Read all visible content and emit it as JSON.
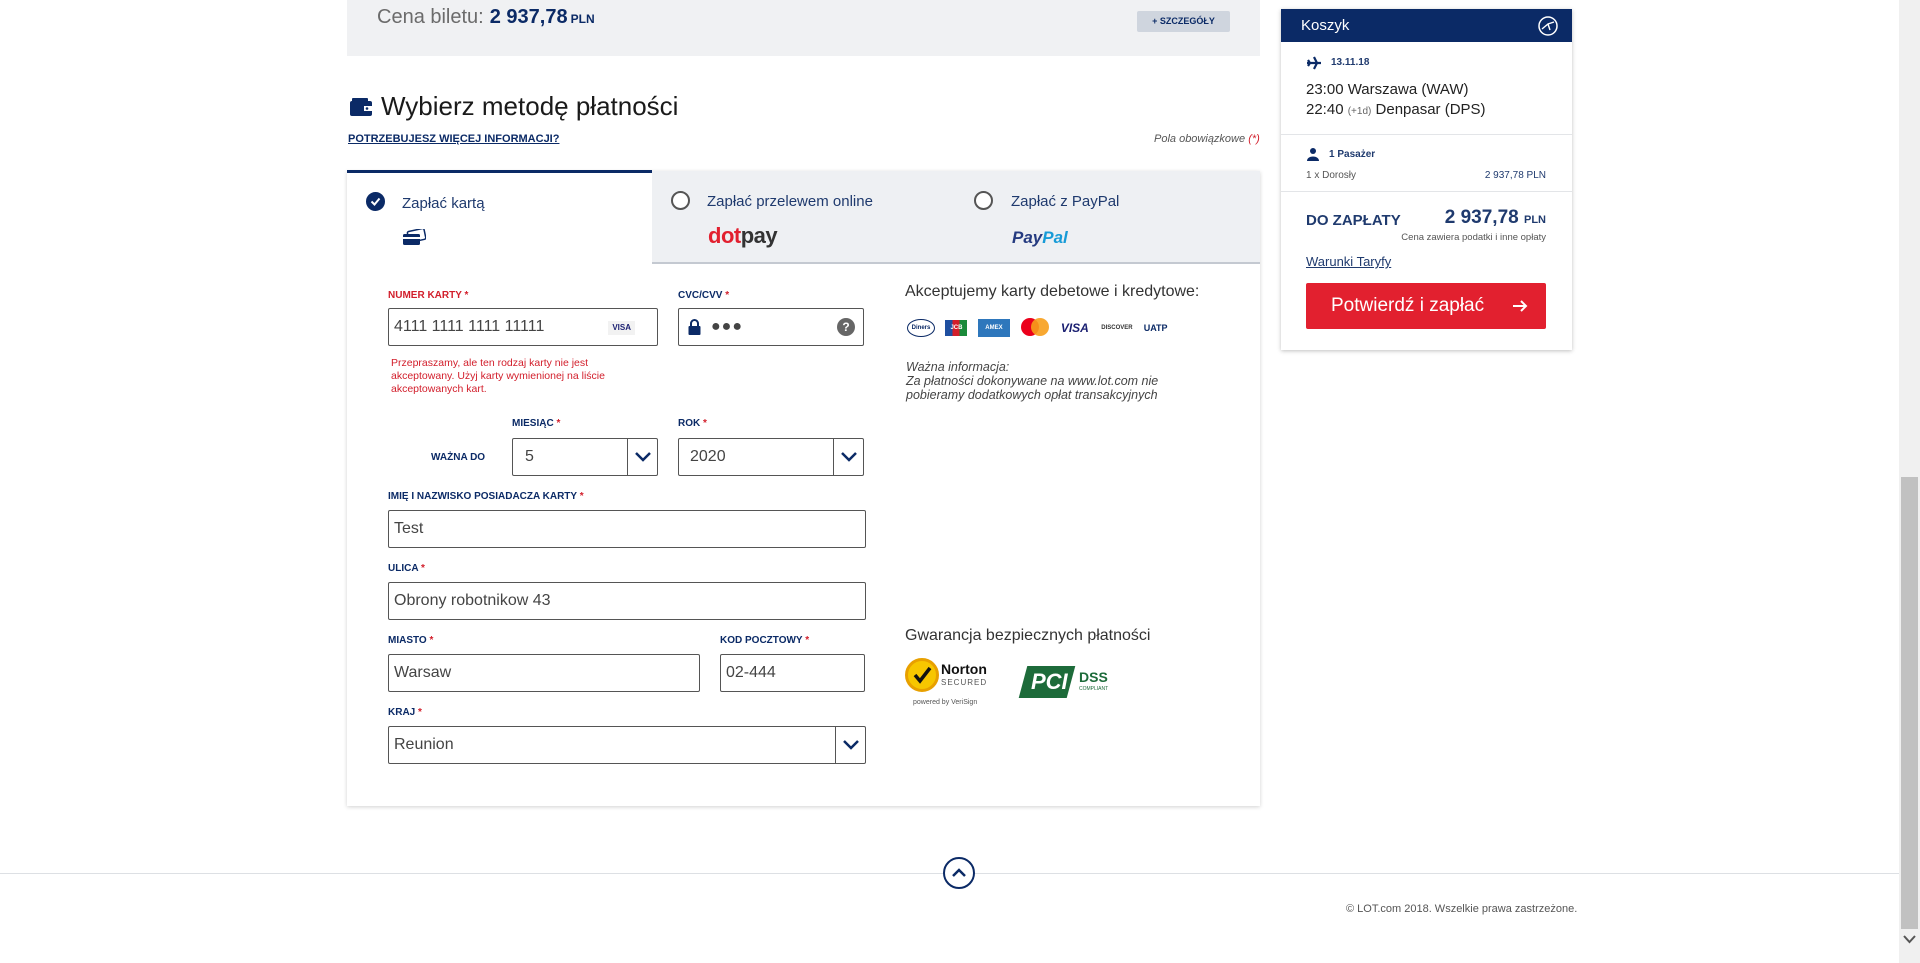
{
  "price_bar": {
    "label": "Cena biletu:",
    "value": "2 937,78",
    "currency": "PLN",
    "details_button": "+ SZCZEGÓŁY"
  },
  "payment_section": {
    "title": "Wybierz metodę płatności",
    "more_info_link": "POTRZEBUJESZ WIĘCEJ INFORMACJI?",
    "required_note": "Pola obowiązkowe",
    "required_star": "(*)"
  },
  "tabs": [
    {
      "label": "Zapłać kartą",
      "selected": true,
      "icon": "credit-card-icon"
    },
    {
      "label": "Zapłać przelewem online",
      "selected": false,
      "logo": "dotpay"
    },
    {
      "label": "Zapłać z PayPal",
      "selected": false,
      "logo": "PayPal"
    }
  ],
  "logos": {
    "dotpay_a": "dot",
    "dotpay_b": "pay",
    "paypal_a": "Pay",
    "paypal_b": "Pal"
  },
  "form": {
    "card_number": {
      "label": "NUMER KARTY",
      "value": "4111 1111 1111 11111",
      "brand": "VISA"
    },
    "card_error": "Przepraszamy, ale ten rodzaj karty nie jest akceptowany. Użyj karty wymienionej na liście akceptowanych kart.",
    "cvc": {
      "label": "CVC/CVV",
      "value": "●●●",
      "help": "?"
    },
    "valid_to_label": "WAŻNA DO",
    "month": {
      "label": "MIESIĄC",
      "value": "5"
    },
    "year": {
      "label": "ROK",
      "value": "2020"
    },
    "holder": {
      "label": "IMIĘ I NAZWISKO POSIADACZA KARTY",
      "value": "Test"
    },
    "street": {
      "label": "ULICA",
      "value": "Obrony robotnikow 43"
    },
    "city": {
      "label": "MIASTO",
      "value": "Warsaw"
    },
    "postal": {
      "label": "KOD POCZTOWY",
      "value": "02-444"
    },
    "country": {
      "label": "KRAJ",
      "value": "Reunion"
    },
    "required_mark": "*"
  },
  "accepted_cards": {
    "title": "Akceptujemy karty debetowe i kredytowe:",
    "cards": [
      "Diners",
      "JCB",
      "AMEX",
      "Mastercard",
      "VISA",
      "DISCOVER",
      "UATP"
    ],
    "info_title": "Ważna informacja:",
    "info_line1": "Za płatności dokonywane na www.lot.com nie",
    "info_line2": "pobieramy dodatkowych opłat transakcyjnych"
  },
  "guarantee": {
    "title": "Gwarancja bezpiecznych płatności",
    "norton": "Norton",
    "norton_sub": "SECURED",
    "norton_powered": "powered by VeriSign",
    "pci": "PCI",
    "dss": "DSS",
    "dss_sub": "COMPLIANT"
  },
  "cart": {
    "title": "Koszyk",
    "date": "13.11.18",
    "departure": "23:00 Warszawa (WAW)",
    "arrival_time": "22:40",
    "arrival_offset": "(+1d)",
    "arrival_place": "Denpasar (DPS)",
    "passengers": "1 Pasażer",
    "passenger_type": "1 x Dorosły",
    "passenger_price": "2 937,78 PLN",
    "to_pay_label": "DO ZAPŁATY",
    "to_pay_value": "2 937,78",
    "to_pay_currency": "PLN",
    "tax_note": "Cena zawiera podatki i inne opłaty",
    "fare_terms": "Warunki Taryfy",
    "confirm_button": "Potwierdź i zapłać"
  },
  "footer": {
    "copyright": "© LOT.com 2018. Wszelkie prawa zastrzeżone."
  },
  "colors": {
    "brand_navy": "#0b2a66",
    "accent_red": "#e2202f",
    "error_red": "#d21e2b"
  }
}
